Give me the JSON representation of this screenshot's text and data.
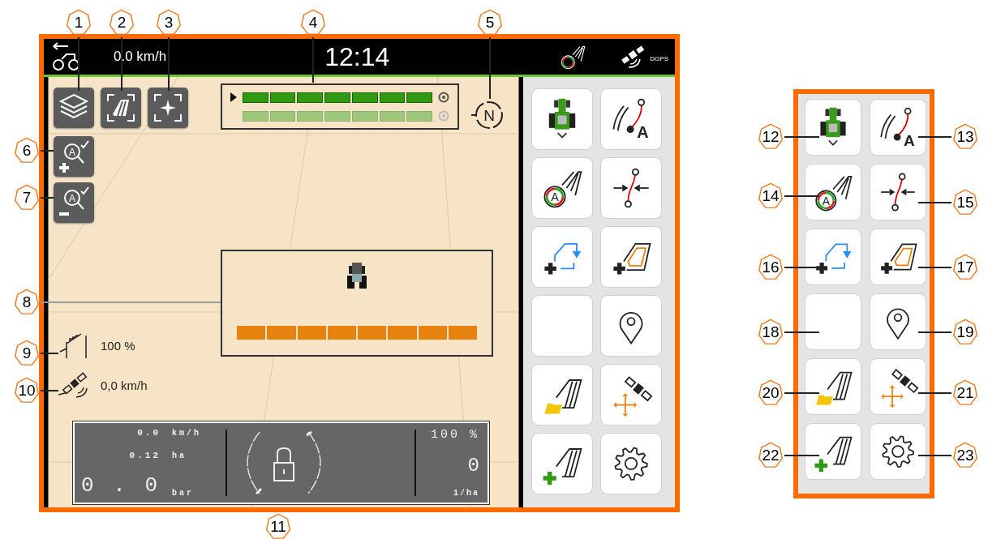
{
  "callouts": [
    {
      "label": "1"
    },
    {
      "label": "2"
    },
    {
      "label": "3"
    },
    {
      "label": "4"
    },
    {
      "label": "5"
    },
    {
      "label": "6"
    },
    {
      "label": "7"
    },
    {
      "label": "8"
    },
    {
      "label": "9"
    },
    {
      "label": "10"
    },
    {
      "label": "11"
    },
    {
      "label": "12"
    },
    {
      "label": "13"
    },
    {
      "label": "14"
    },
    {
      "label": "15"
    },
    {
      "label": "16"
    },
    {
      "label": "17"
    },
    {
      "label": "18"
    },
    {
      "label": "19"
    },
    {
      "label": "20"
    },
    {
      "label": "21"
    },
    {
      "label": "22"
    },
    {
      "label": "23"
    }
  ],
  "status_bar": {
    "speed": "0.0 km/h",
    "time": "12:14",
    "gps_mode": "DGPS"
  },
  "map_buttons": [
    {
      "kind": "layers"
    },
    {
      "kind": "field_view"
    },
    {
      "kind": "center"
    },
    {
      "kind": "zoom_in",
      "glyph": "A"
    },
    {
      "kind": "zoom_out",
      "glyph": "A"
    }
  ],
  "section_bar": {
    "rows": [
      {
        "active": true
      },
      {
        "active": false
      }
    ]
  },
  "compass": {
    "label": "N"
  },
  "boom": {
    "sections": [
      {
        "on": true
      },
      {
        "on": true
      },
      {
        "on": true
      },
      {
        "on": true
      },
      {
        "on": true
      },
      {
        "on": true
      },
      {
        "on": true
      },
      {
        "on": true
      }
    ]
  },
  "info": [
    {
      "kind": "rate",
      "text": "100 %"
    },
    {
      "kind": "gps_speed",
      "text": "0,0 km/h"
    }
  ],
  "dashboard": {
    "rows": [
      {
        "value": "0.0",
        "unit": "km/h"
      },
      {
        "value": "0.12",
        "unit": "ha"
      },
      {
        "value": "0 . 0",
        "unit": "bar"
      }
    ],
    "locked": true,
    "rate": "100 %",
    "count": "0",
    "count_unit": "1/ha"
  },
  "menu_buttons": [
    {
      "kind": "tractor"
    },
    {
      "kind": "track_a",
      "glyph": "A"
    },
    {
      "kind": "autoguide",
      "glyph": "A"
    },
    {
      "kind": "track_shift"
    },
    {
      "kind": "boundary_new"
    },
    {
      "kind": "boundary_headland"
    },
    {
      "kind": "blank"
    },
    {
      "kind": "location"
    },
    {
      "kind": "field_open"
    },
    {
      "kind": "satellite_move"
    },
    {
      "kind": "field_new"
    },
    {
      "kind": "settings"
    }
  ],
  "menu_detail": {
    "buttons": [
      {
        "kind": "tractor"
      },
      {
        "kind": "track_a",
        "glyph": "A"
      },
      {
        "kind": "autoguide",
        "glyph": "A"
      },
      {
        "kind": "track_shift"
      },
      {
        "kind": "boundary_new"
      },
      {
        "kind": "boundary_headland"
      },
      {
        "kind": "blank"
      },
      {
        "kind": "location"
      },
      {
        "kind": "field_open"
      },
      {
        "kind": "satellite_move"
      },
      {
        "kind": "field_new"
      },
      {
        "kind": "settings"
      }
    ]
  }
}
